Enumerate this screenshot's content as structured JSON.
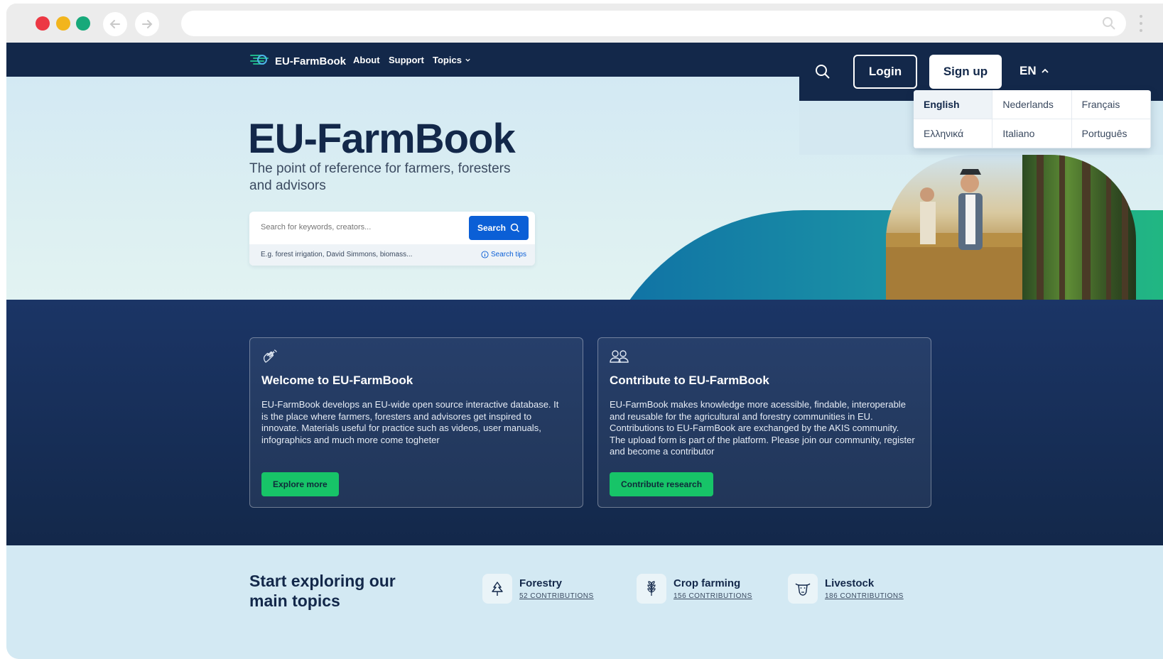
{
  "browser": {
    "icons": {
      "back": "arrow-left-icon",
      "forward": "arrow-right-icon",
      "search": "search-icon",
      "menu": "kebab-menu-icon"
    }
  },
  "nav": {
    "brand": "EU-FarmBook",
    "about": "About",
    "support": "Support",
    "topics": "Topics"
  },
  "header_actions": {
    "login": "Login",
    "signup": "Sign up",
    "language": "EN"
  },
  "languages": [
    "English",
    "Nederlands",
    "Français",
    "Ελληνικά",
    "Italiano",
    "Português"
  ],
  "active_language": "English",
  "hero": {
    "title": "EU-FarmBook",
    "subtitle": "The point of reference for farmers, foresters and advisors",
    "search_placeholder": "Search for keywords, creators...",
    "search_button": "Search",
    "search_hint": "E.g. forest irrigation, David Simmons, biomass...",
    "search_tips": "Search tips"
  },
  "cards": [
    {
      "title": "Welcome to EU-FarmBook",
      "body": "EU-FarmBook develops an EU-wide open source interactive database. It is the place where farmers, foresters and advisores get inspired to innovate. Materials useful for practice such as videos, user manuals, infographics and much more come togheter",
      "button": "Explore more"
    },
    {
      "title": "Contribute to EU-FarmBook",
      "body": "EU-FarmBook makes knowledge more acessible, findable, interoperable and reusable for the agricultural and forestry communities in EU. Contributions to EU-FarmBook are exchanged by the AKIS community. The upload form is part of the platform. Please join our community, register and become a contributor",
      "button": "Contribute research"
    }
  ],
  "topics": {
    "title": "Start exploring our main topics",
    "items": [
      {
        "name": "Forestry",
        "count": "52 CONTRIBUTIONS",
        "icon": "tree-icon"
      },
      {
        "name": "Crop farming",
        "count": "156 CONTRIBUTIONS",
        "icon": "wheat-icon"
      },
      {
        "name": "Livestock",
        "count": "186 CONTRIBUTIONS",
        "icon": "cow-icon"
      }
    ]
  },
  "colors": {
    "navy": "#13284a",
    "primary_blue": "#0b5fd6",
    "green": "#17c468",
    "light_bg": "#d3e9f3"
  }
}
